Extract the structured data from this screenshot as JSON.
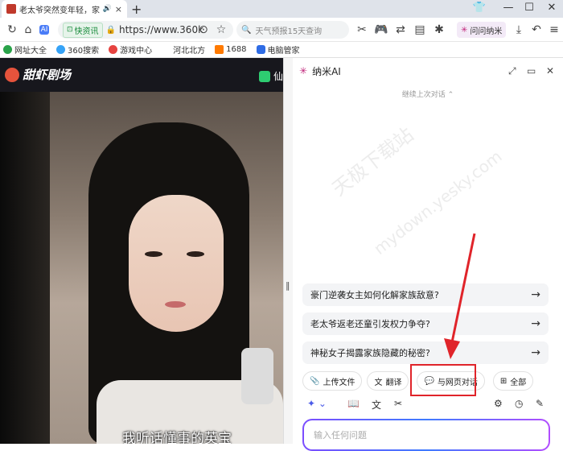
{
  "tab": {
    "title": "老太爷突然变年轻，家族",
    "close": "×"
  },
  "new_tab": "+",
  "window_controls": [
    "⬚",
    "—",
    "☐",
    "✕"
  ],
  "address": {
    "badge": "快资讯",
    "url": "https://www.360k",
    "search_placeholder": "天气预报15天查询",
    "ai_button": "问问纳米"
  },
  "bookmarks": [
    {
      "label": "网址大全",
      "color": "#2aa34a"
    },
    {
      "label": "360搜索",
      "color": "#36a3f7"
    },
    {
      "label": "游戏中心",
      "color": "#e64340"
    },
    {
      "label": "河北北方",
      "color": "#ffffff"
    },
    {
      "label": "1688",
      "color": "#ff7a00"
    },
    {
      "label": "电脑管家",
      "color": "#2f6ce5"
    }
  ],
  "video": {
    "site_name": "甜虾剧场",
    "xian_label": "仙",
    "subtitle": "我听话懂事的英宝"
  },
  "panel": {
    "title": "纳米AI",
    "history_link": "继续上次对话 ⌃",
    "suggestions": [
      "豪门逆袭女主如何化解家族敌意?",
      "老太爷返老还童引发权力争夺?",
      "神秘女子揭露家族隐藏的秘密?"
    ],
    "chips": [
      "上传文件",
      "翻译",
      "与网页对话",
      "全部"
    ],
    "input_placeholder": "输入任何问题"
  },
  "watermark": {
    "line1": "天极下载站",
    "line2": "mydown.yesky.com"
  },
  "colors": {
    "highlight": "#e0242a",
    "accent": "#7c4dff"
  }
}
